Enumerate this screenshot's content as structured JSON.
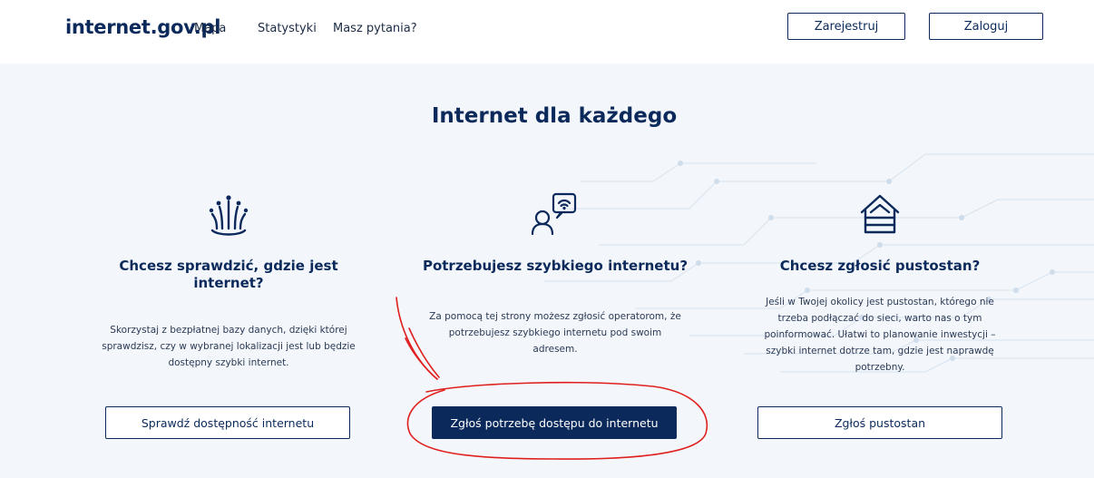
{
  "header": {
    "logo": "internet.gov.pl",
    "nav": [
      {
        "label": "Mapa"
      },
      {
        "label": "Statystyki"
      },
      {
        "label": "Masz pytania?"
      }
    ],
    "register_label": "Zarejestruj",
    "login_label": "Zaloguj"
  },
  "hero": {
    "title": "Internet dla każdego"
  },
  "columns": [
    {
      "icon": "fiber-optic-icon",
      "heading": "Chcesz sprawdzić, gdzie jest internet?",
      "lines": [
        "Skorzystaj z bezpłatnej bazy danych, dzięki której",
        "sprawdzisz, czy w wybranej lokalizacji jest lub będzie",
        "dostępny szybki internet."
      ],
      "button": "Sprawdź dostępność internetu"
    },
    {
      "icon": "user-wifi-request-icon",
      "heading": "Potrzebujesz szybkiego internetu?",
      "lines": [
        "Za pomocą tej strony możesz zgłosić operatorom, że",
        "potrzebujesz szybkiego internetu pod swoim",
        "adresem."
      ],
      "button": "Zgłoś potrzebę dostępu do internetu"
    },
    {
      "icon": "empty-house-icon",
      "heading": "Chcesz zgłosić pustostan?",
      "lines": [
        "Jeśli w Twojej okolicy jest pustostan, którego nie",
        "trzeba podłączać do sieci, warto nas o tym",
        "poinformować. Ułatwi to planowanie inwestycji –",
        "szybki internet dotrze tam, gdzie jest naprawdę",
        "potrzebny."
      ],
      "button": "Zgłoś pustostan"
    }
  ],
  "colors": {
    "primary": "#0b2a5b",
    "background": "#f3f6fb",
    "annotation": "#e0201e"
  }
}
